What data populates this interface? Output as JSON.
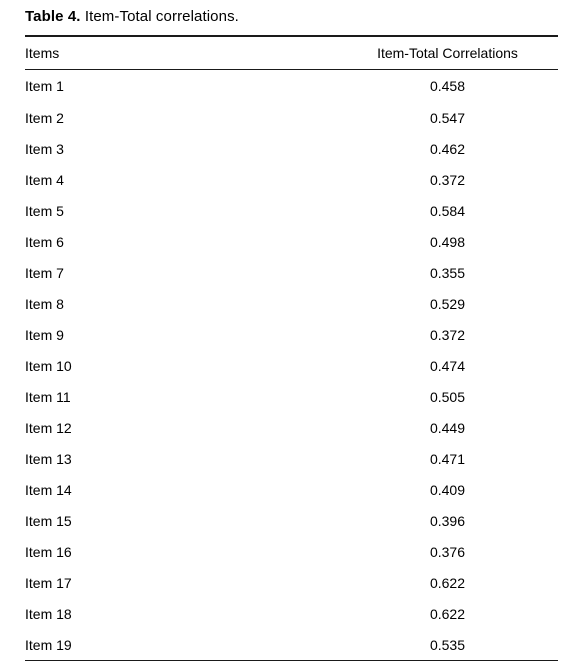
{
  "caption": {
    "label": "Table 4.",
    "text": " Item-Total correlations."
  },
  "table": {
    "columns": [
      {
        "key": "item",
        "header": "Items",
        "align": "left"
      },
      {
        "key": "correlation",
        "header": "Item-Total Correlations",
        "align": "center"
      }
    ],
    "rows": [
      {
        "item": "Item 1",
        "correlation": "0.458"
      },
      {
        "item": "Item 2",
        "correlation": "0.547"
      },
      {
        "item": "Item 3",
        "correlation": "0.462"
      },
      {
        "item": "Item 4",
        "correlation": "0.372"
      },
      {
        "item": "Item 5",
        "correlation": "0.584"
      },
      {
        "item": "Item 6",
        "correlation": "0.498"
      },
      {
        "item": "Item 7",
        "correlation": "0.355"
      },
      {
        "item": "Item 8",
        "correlation": "0.529"
      },
      {
        "item": "Item 9",
        "correlation": "0.372"
      },
      {
        "item": "Item 10",
        "correlation": "0.474"
      },
      {
        "item": "Item 11",
        "correlation": "0.505"
      },
      {
        "item": "Item 12",
        "correlation": "0.449"
      },
      {
        "item": "Item 13",
        "correlation": "0.471"
      },
      {
        "item": "Item 14",
        "correlation": "0.409"
      },
      {
        "item": "Item 15",
        "correlation": "0.396"
      },
      {
        "item": "Item 16",
        "correlation": "0.376"
      },
      {
        "item": "Item 17",
        "correlation": "0.622"
      },
      {
        "item": "Item 18",
        "correlation": "0.622"
      },
      {
        "item": "Item 19",
        "correlation": "0.535"
      }
    ]
  },
  "colors": {
    "background": "#ffffff",
    "text": "#000000",
    "rule": "#1a1a1a"
  }
}
